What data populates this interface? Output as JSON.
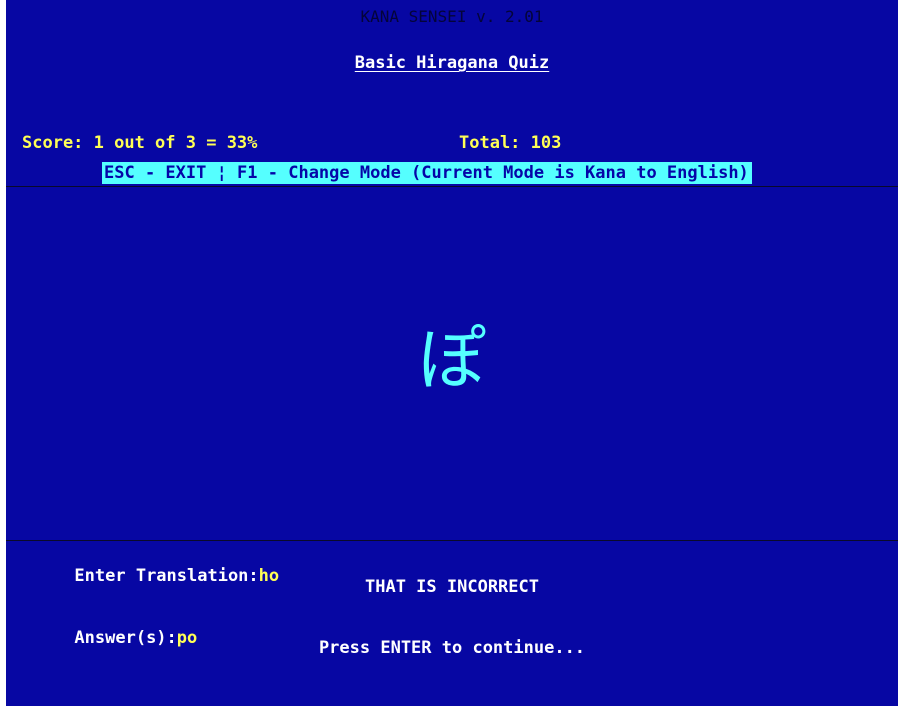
{
  "colors": {
    "background": "#0707a3",
    "title_text": "#040439",
    "white_text": "#ffffff",
    "yellow_text": "#ffff55",
    "help_bar_bg": "#55ffff",
    "help_bar_text": "#0505a8",
    "kana_color": "#55ffff",
    "divider": "#0a0a2a"
  },
  "header": {
    "app_title": "KANA SENSEI v. 2.01",
    "quiz_title": "Basic Hiragana Quiz"
  },
  "stats": {
    "score": "Score: 1 out of 3 = 33%",
    "total": "Total: 103"
  },
  "help_bar": {
    "text": "ESC - EXIT ¦ F1 - Change Mode (Current Mode is Kana to English)"
  },
  "quiz": {
    "kana": "ぽ"
  },
  "response": {
    "prompt_label": "Enter Translation:",
    "prompt_value": "ho",
    "feedback": "THAT IS INCORRECT",
    "answers_label": "Answer(s):",
    "answers_value": "po",
    "continue_text": "Press ENTER to continue..."
  }
}
